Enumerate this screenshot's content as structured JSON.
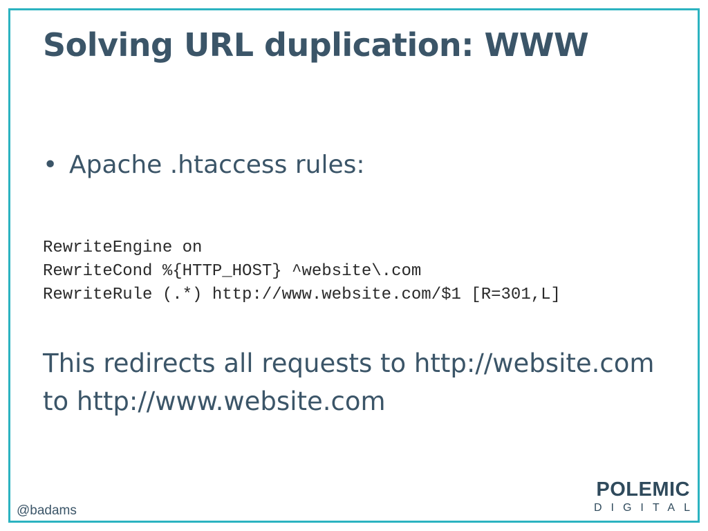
{
  "slide": {
    "title": "Solving URL duplication: WWW",
    "bullet": {
      "marker": "•",
      "text": "Apache .htaccess rules:"
    },
    "code_lines": [
      "RewriteEngine on",
      "RewriteCond %{HTTP_HOST} ^website\\.com",
      "RewriteRule (.*) http://www.website.com/$1 [R=301,L]"
    ],
    "description_lines": [
      "This redirects all requests to http://website.com",
      "to http://www.website.com"
    ],
    "footer": {
      "handle": "@badams",
      "logo_main": "POLEMIC",
      "logo_sub": "DIGITAL"
    }
  },
  "colors": {
    "frame_border": "#2bb3c0",
    "heading_text": "#3b5568",
    "code_text": "#2a2a2a",
    "logo_text": "#2f4a5c"
  }
}
